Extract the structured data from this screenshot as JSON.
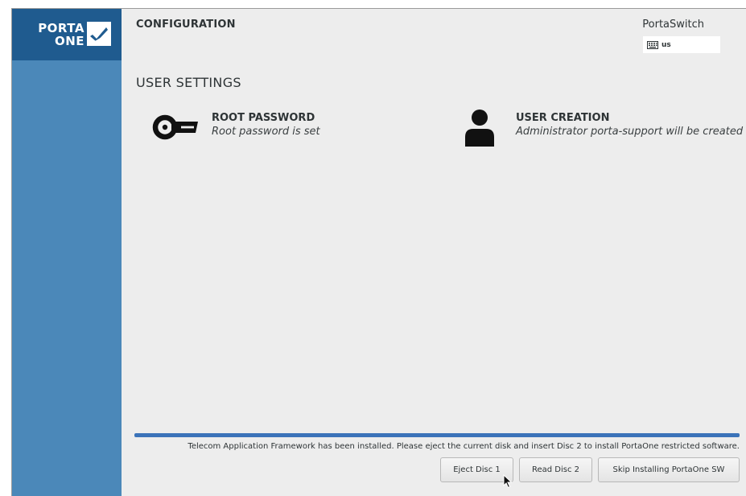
{
  "logo": {
    "line1": "PORTA",
    "line2": "ONE"
  },
  "header": {
    "title": "CONFIGURATION",
    "product": "PortaSwitch",
    "keyboard_layout": "us"
  },
  "section": {
    "title": "USER SETTINGS"
  },
  "spokes": {
    "root_password": {
      "title": "ROOT PASSWORD",
      "status": "Root password is set",
      "icon": "key-icon"
    },
    "user_creation": {
      "title": "USER CREATION",
      "status": "Administrator porta-support will be created",
      "icon": "user-icon"
    }
  },
  "progress": {
    "fraction": 1.0
  },
  "status_message": "Telecom Application Framework has been installed. Please eject the current disk and insert Disc 2 to install PortaOne restricted software.",
  "buttons": {
    "eject": "Eject Disc 1",
    "read": "Read Disc 2",
    "skip": "Skip Installing PortaOne SW"
  },
  "colors": {
    "sidebar": "#4b88b9",
    "sidebar_top": "#1f5b8f",
    "progress": "#3b73b9",
    "background": "#ededed"
  }
}
